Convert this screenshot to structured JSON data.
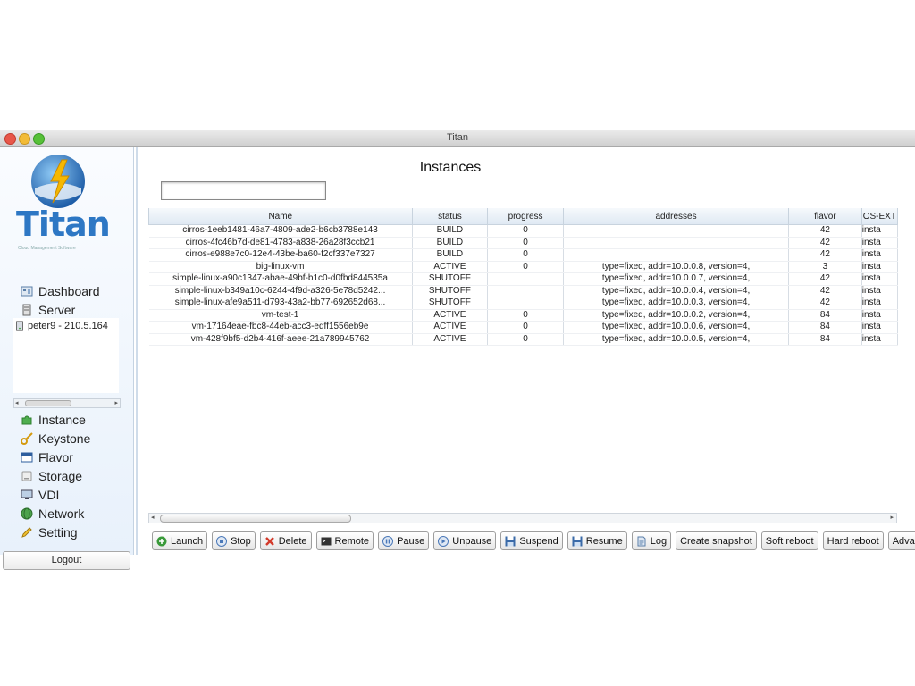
{
  "window": {
    "title": "Titan"
  },
  "logo": {
    "text": "Titan",
    "subtitle": "Cloud Management Software"
  },
  "sidebar": {
    "top_items": [
      {
        "label": "Dashboard",
        "icon": "dashboard-icon"
      },
      {
        "label": "Server",
        "icon": "server-icon"
      }
    ],
    "tree_items": [
      {
        "label": "peter9 - 210.5.164",
        "icon": "server-node-icon"
      }
    ],
    "bottom_items": [
      {
        "label": "Instance",
        "icon": "puzzle-icon"
      },
      {
        "label": "Keystone",
        "icon": "key-icon"
      },
      {
        "label": "Flavor",
        "icon": "window-icon"
      },
      {
        "label": "Storage",
        "icon": "storage-icon"
      },
      {
        "label": "VDI",
        "icon": "monitor-icon"
      },
      {
        "label": "Network",
        "icon": "globe-icon"
      },
      {
        "label": "Setting",
        "icon": "pencil-icon"
      }
    ],
    "logout_label": "Logout"
  },
  "main": {
    "title": "Instances",
    "search": {
      "value": "",
      "placeholder": ""
    },
    "table": {
      "columns": [
        "Name",
        "status",
        "progress",
        "addresses",
        "flavor",
        "OS-EXT"
      ],
      "rows": [
        [
          "cirros-1eeb1481-46a7-4809-ade2-b6cb3788e143",
          "BUILD",
          "0",
          "",
          "42",
          "insta"
        ],
        [
          "cirros-4fc46b7d-de81-4783-a838-26a28f3ccb21",
          "BUILD",
          "0",
          "",
          "42",
          "insta"
        ],
        [
          "cirros-e988e7c0-12e4-43be-ba60-f2cf337e7327",
          "BUILD",
          "0",
          "",
          "42",
          "insta"
        ],
        [
          "big-linux-vm",
          "ACTIVE",
          "0",
          "type=fixed, addr=10.0.0.8, version=4,",
          "3",
          "insta"
        ],
        [
          "simple-linux-a90c1347-abae-49bf-b1c0-d0fbd844535a",
          "SHUTOFF",
          "",
          "type=fixed, addr=10.0.0.7, version=4,",
          "42",
          "insta"
        ],
        [
          "simple-linux-b349a10c-6244-4f9d-a326-5e78d5242...",
          "SHUTOFF",
          "",
          "type=fixed, addr=10.0.0.4, version=4,",
          "42",
          "insta"
        ],
        [
          "simple-linux-afe9a511-d793-43a2-bb77-692652d68...",
          "SHUTOFF",
          "",
          "type=fixed, addr=10.0.0.3, version=4,",
          "42",
          "insta"
        ],
        [
          "vm-test-1",
          "ACTIVE",
          "0",
          "type=fixed, addr=10.0.0.2, version=4,",
          "84",
          "insta"
        ],
        [
          "vm-17164eae-fbc8-44eb-acc3-edff1556eb9e",
          "ACTIVE",
          "0",
          "type=fixed, addr=10.0.0.6, version=4,",
          "84",
          "insta"
        ],
        [
          "vm-428f9bf5-d2b4-416f-aeee-21a789945762",
          "ACTIVE",
          "0",
          "type=fixed, addr=10.0.0.5, version=4,",
          "84",
          "insta"
        ]
      ]
    },
    "toolbar": [
      {
        "label": "Launch",
        "icon": "plus-circle-icon",
        "color": "#3a9a3a"
      },
      {
        "label": "Stop",
        "icon": "stop-icon",
        "color": "#4a78b8"
      },
      {
        "label": "Delete",
        "icon": "delete-x-icon",
        "color": "#d33a2a"
      },
      {
        "label": "Remote",
        "icon": "terminal-icon",
        "color": "#333333"
      },
      {
        "label": "Pause",
        "icon": "pause-icon",
        "color": "#4a78b8"
      },
      {
        "label": "Unpause",
        "icon": "play-icon",
        "color": "#4a78b8"
      },
      {
        "label": "Suspend",
        "icon": "floppy-icon",
        "color": "#3a6aa8"
      },
      {
        "label": "Resume",
        "icon": "floppy-icon",
        "color": "#3a6aa8"
      },
      {
        "label": "Log",
        "icon": "log-icon",
        "color": "#5a7ea8"
      },
      {
        "label": "Create snapshot",
        "icon": "",
        "color": ""
      },
      {
        "label": "Soft reboot",
        "icon": "",
        "color": ""
      },
      {
        "label": "Hard reboot",
        "icon": "",
        "color": ""
      },
      {
        "label": "Advance",
        "icon": "",
        "color": ""
      }
    ]
  }
}
